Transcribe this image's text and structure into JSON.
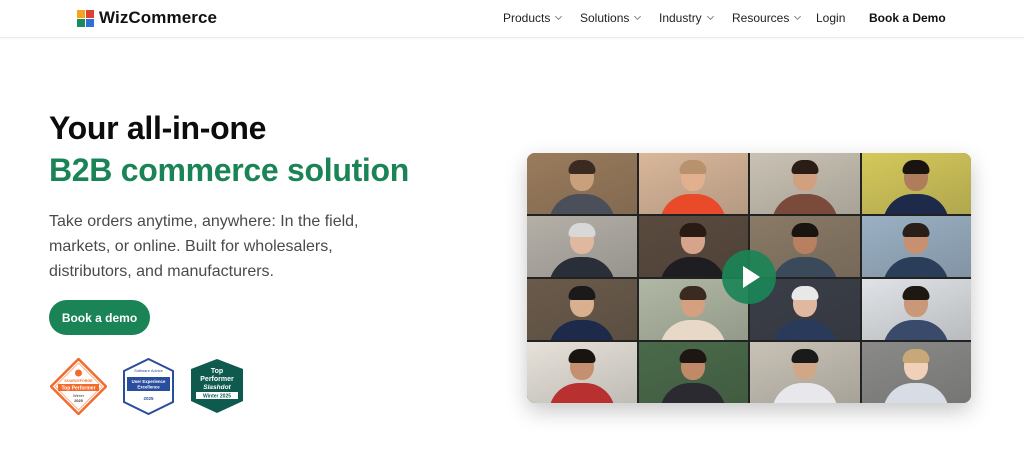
{
  "header": {
    "brand": "WizCommerce",
    "nav": [
      {
        "label": "Products",
        "dropdown": true
      },
      {
        "label": "Solutions",
        "dropdown": true
      },
      {
        "label": "Industry",
        "dropdown": true
      },
      {
        "label": "Resources",
        "dropdown": true
      },
      {
        "label": "Login",
        "dropdown": false
      },
      {
        "label": "Book a Demo",
        "dropdown": false
      }
    ]
  },
  "hero": {
    "title_line1": "Your all-in-one",
    "title_line2": "B2B commerce solution",
    "description": "Take orders anytime, anywhere: In the field, markets, or online. Built for wholesalers, distributors, and manufacturers.",
    "cta_label": "Book a demo"
  },
  "badges": {
    "sourceforge": {
      "brand": "SOURCEFORGE",
      "title": "Top Performer",
      "season": "Winter",
      "year": "2025"
    },
    "softwareadvice": {
      "brand": "Software Advice",
      "line1": "User Experience",
      "line2": "Excellence",
      "year": "2025"
    },
    "slashdot": {
      "line1": "Top",
      "line2": "Performer",
      "brand": "Slashdot",
      "season": "Winter 2025"
    }
  },
  "colors": {
    "brand_green": "#1b8457",
    "title_dark": "#0c0c0c",
    "sourceforge_orange": "#f26a2c",
    "softwareadvice_blue": "#2a4d9e",
    "slashdot_teal": "#0f5a4f"
  },
  "icons": {
    "logo": "wizcommerce-logo-icon",
    "play": "play-icon",
    "dropdown": "chevron-down-icon"
  }
}
